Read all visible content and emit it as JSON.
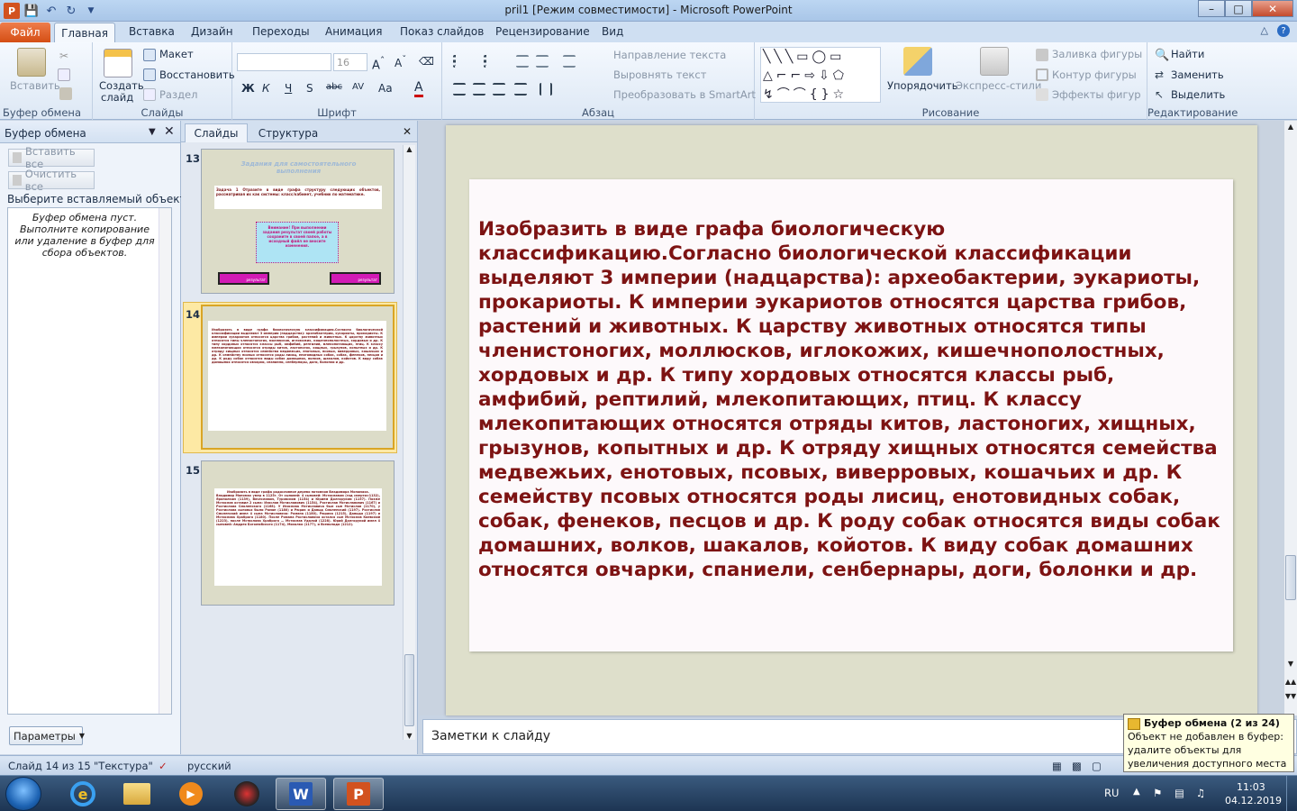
{
  "window": {
    "title": "pril1 [Режим совместимости]  -  Microsoft PowerPoint",
    "controls": [
      "–",
      "□",
      "✕"
    ]
  },
  "ribbon_tabs": {
    "file": "Файл",
    "items": [
      "Главная",
      "Вставка",
      "Дизайн",
      "Переходы",
      "Анимация",
      "Показ слайдов",
      "Рецензирование",
      "Вид"
    ]
  },
  "ribbon": {
    "clipboard": {
      "paste": "Вставить",
      "label": "Буфер обмена"
    },
    "slides": {
      "new_slide": "Создать",
      "new_slide2": "слайд",
      "layout": "Макет",
      "reset": "Восстановить",
      "section": "Раздел",
      "label": "Слайды"
    },
    "font": {
      "size": "16",
      "label": "Шрифт",
      "buttons": [
        "Ж",
        "К",
        "Ч",
        "S",
        "abc",
        "AV",
        "Aa",
        "A"
      ]
    },
    "paragraph": {
      "text_direction": "Направление текста",
      "align_text": "Выровнять текст",
      "smartart": "Преобразовать в SmartArt",
      "label": "Абзац"
    },
    "drawing": {
      "arrange": "Упорядочить",
      "quick_styles": "Экспресс-стили",
      "fill": "Заливка фигуры",
      "outline": "Контур фигуры",
      "effects": "Эффекты фигур",
      "label": "Рисование"
    },
    "editing": {
      "find": "Найти",
      "replace": "Заменить",
      "select": "Выделить",
      "label": "Редактирование"
    }
  },
  "clipboard_pane": {
    "title": "Буфер обмена",
    "paste_all": "Вставить все",
    "clear_all": "Очистить все",
    "select_prompt": "Выберите вставляемый объект:",
    "empty_message": "Буфер обмена пуст. Выполните копирование или удаление в буфер для сбора объектов.",
    "options": "Параметры"
  },
  "thumb_pane": {
    "tabs": [
      "Слайды",
      "Структура"
    ],
    "slides": [
      {
        "number": "13",
        "title": "Задания для самостоятельного выполнения",
        "task": "Задача 1 Отразите в виде графа структуру следующих объектов, рассматривая их как системы: класс/кабинет, учебник по математике.",
        "note": "Внимание! При выполнении задания результат своей работы сохраните в своей папке, а в исходный файл не вносите изменения.",
        "btn1": "результат",
        "btn2": "результат"
      },
      {
        "number": "14",
        "text": "Изобразить в виде графа биологическую классификацию.Согласно биологической классификации выделяют 3 империи (надцарства): археобактерии, эукариоты, прокариоты. К империи эукариотов относятся царства грибов, растений и животных. К царству животных относятся типы членистоногих, моллюсков, иглокожих, кишечнополостных, хордовых и др. К типу хордовых относятся классы рыб, амфибий, рептилий, млекопитающих, птиц. К классу млекопитающих относятся отряды китов, ластоногих, хищных, грызунов, копытных и др. К отряду хищных относятся семейства медвежьих, енотовых, псовых, виверровых, кошачьих и др. К семейству псовых относятся роды лисиц, енотовидных собак, собак, фенеков, песцов и др. К роду собак относятся виды собак домашних, волков, шакалов, койотов. К виду собак домашних относятся овчарки, спаниели, сенбернары, доги, болонки и др."
      },
      {
        "number": "15",
        "title": "Изобразить в виде графа родословное дерево потомков Владимира Мономаха.",
        "text": "Владимир Мономах умер в 1125г. От сыновей: 4 сыновей: Мстиславом (год смерти=1132), Ярополком (1139), Вячеславом, Туровским (1154) и Юрием Долгоруким (1157). Позже Мстислав оставил 2 сына: Изяслав Мстиславович (1154), Ростислав Мстиславович (1167) и Ростислава Смоленского (1168). У Изяслава Мстиславича был сын Мстислав (1170), у Ростислава сыновья были Роман (1180) и Рюрик и Давыд Смоленский (1197). Ростислав Смоленский имел 4 сына Мстиславича: Романа (1180), Рюрика (1215), Давыда (1197) и Мстислава Храброго (1180). После Романа Ростиславича остался сын Мстислав Киевский (1223), после Мстислава Храброго — Мстислав Удалой (1228). Юрий Долгорукий имел 4 сыновей: Андрея Боголюбского (1174), Михалко (1177), и Всеволода (1212)."
      }
    ]
  },
  "slide": {
    "text": "Изобразить в виде графа биологическую классификацию.Согласно биологической классификации выделяют 3 империи (надцарства): археобактерии, эукариоты, прокариоты. К империи эукариотов относятся царства грибов, растений и животных. К царству животных относятся типы членистоногих, моллюсков, иглокожих, кишечнополостных, хордовых и др. К типу хордовых  относятся классы рыб, амфибий, рептилий, млекопитающих, птиц. К классу млекопитающих относятся отряды китов, ластоногих, хищных, грызунов, копытных и др. К отряду хищных относятся семейства медвежьих, енотовых, псовых, виверровых, кошачьих и др. К семейству псовых относятся роды лисиц, енотовидных собак, собак, фенеков, песцов и др. К роду собак относятся виды собак домашних, волков, шакалов, койотов. К виду собак домашних относятся овчарки, спаниели, сенбернары, доги, болонки и др.",
    "text_color": "#7d1313"
  },
  "notes": {
    "placeholder": "Заметки к слайду"
  },
  "statusbar": {
    "slide": "Слайд 14 из 15",
    "theme": "\"Текстура\"",
    "language": "русский"
  },
  "tooltip": {
    "title": "Буфер обмена (2 из 24)",
    "body": "Объект не добавлен в буфер: удалите объекты для увеличения доступного места"
  },
  "taskbar": {
    "lang": "RU",
    "time": "11:03",
    "date": "04.12.2019"
  },
  "colors": {
    "accent": "#d44e14",
    "ribbon": "#dde8f5",
    "slide_bg": "#dedfcb"
  }
}
